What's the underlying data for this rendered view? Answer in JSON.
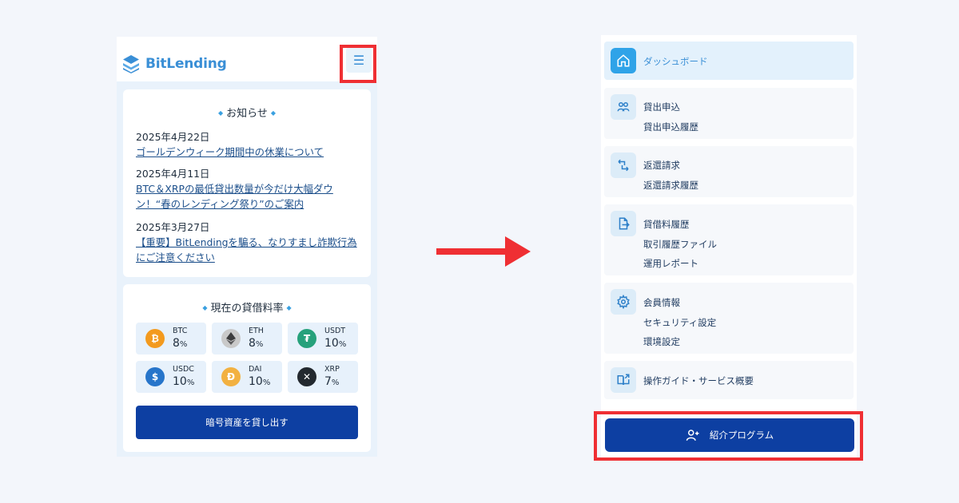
{
  "left": {
    "logo_text": "BitLending",
    "menu_icon": "hamburger-icon",
    "news": {
      "title": "お知らせ",
      "items": [
        {
          "date": "2025年4月22日",
          "title": "ゴールデンウィーク期間中の休業について"
        },
        {
          "date": "2025年4月11日",
          "title": "BTC＆XRPの最低貸出数量が今だけ大幅ダウン！“春のレンディング祭り”のご案内"
        },
        {
          "date": "2025年3月27日",
          "title": "【重要】BitLendingを騙る、なりすまし詐欺行為にご注意ください"
        }
      ]
    },
    "rates": {
      "title": "現在の貸借料率",
      "coins": [
        {
          "name": "BTC",
          "rate": "8",
          "unit": "%",
          "color": "#f39a1e",
          "icon": "bitcoin-icon"
        },
        {
          "name": "ETH",
          "rate": "8",
          "unit": "%",
          "color": "#c9c9c9",
          "icon": "ethereum-icon"
        },
        {
          "name": "USDT",
          "rate": "10",
          "unit": "%",
          "color": "#26a17b",
          "icon": "tether-icon"
        },
        {
          "name": "USDC",
          "rate": "10",
          "unit": "%",
          "color": "#2775ca",
          "icon": "usdc-icon"
        },
        {
          "name": "DAI",
          "rate": "10",
          "unit": "%",
          "color": "#f2b141",
          "icon": "dai-icon"
        },
        {
          "name": "XRP",
          "rate": "7",
          "unit": "%",
          "color": "#23292f",
          "icon": "xrp-icon"
        }
      ],
      "button": "暗号資産を貸し出す"
    }
  },
  "right": {
    "menu": [
      {
        "icon": "home-icon",
        "items": [
          "ダッシュボード"
        ],
        "active": true
      },
      {
        "icon": "users-icon",
        "items": [
          "貸出申込",
          "貸出申込履歴"
        ]
      },
      {
        "icon": "return-icon",
        "items": [
          "返還請求",
          "返還請求履歴"
        ]
      },
      {
        "icon": "file-export-icon",
        "items": [
          "貸借料履歴",
          "取引履歴ファイル",
          "運用レポート"
        ]
      },
      {
        "icon": "gear-icon",
        "items": [
          "会員情報",
          "セキュリティ設定",
          "環境設定"
        ]
      },
      {
        "icon": "book-icon",
        "items": [
          "操作ガイド・サービス概要"
        ]
      }
    ],
    "referral_button": "紹介プログラム"
  },
  "colors": {
    "highlight": "#ef2f33",
    "primary_button": "#0d3fa2",
    "accent": "#3a8fd6"
  }
}
